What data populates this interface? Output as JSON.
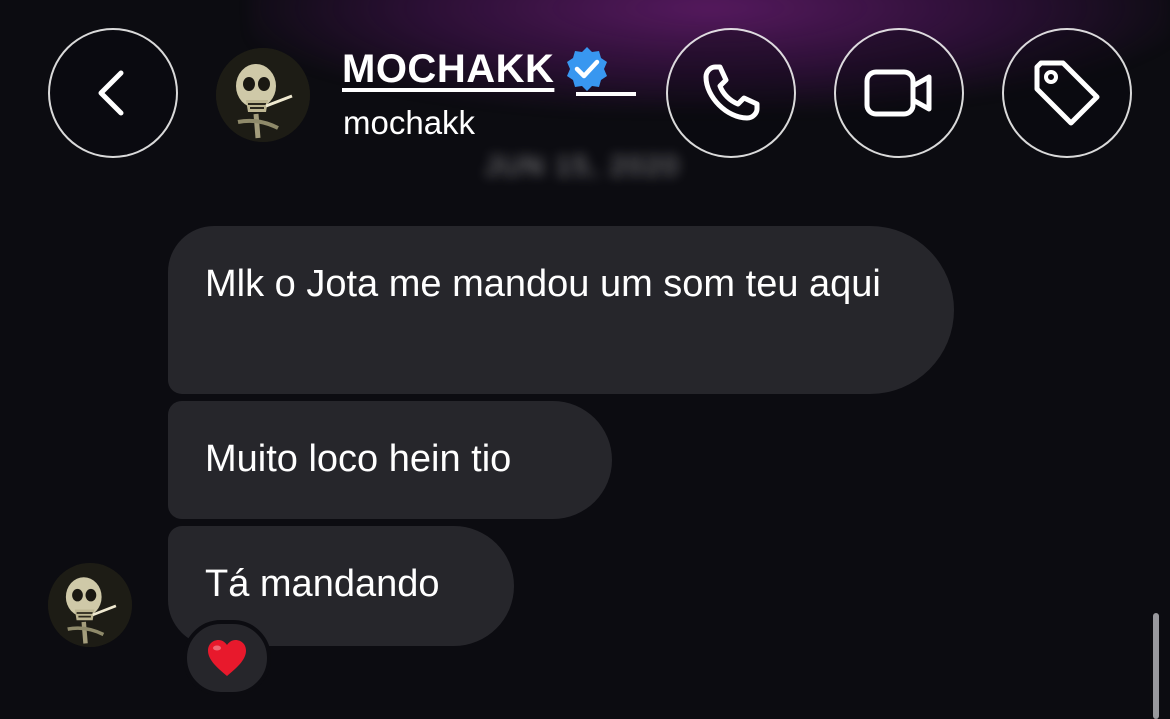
{
  "header": {
    "display_name": "MOCHAKK",
    "username": "mochakk",
    "date_label": "JUN 15, 2020",
    "icons": {
      "back": "chevron-left-icon",
      "call": "phone-icon",
      "video": "video-camera-icon",
      "tag": "tag-icon",
      "verified": "verified-badge-icon"
    },
    "colors": {
      "verified_blue": "#3897f0",
      "glow_purple": "#6e1e78"
    }
  },
  "messages": [
    {
      "text": "Mlk o Jota me mandou um som teu aqui"
    },
    {
      "text": "Muito loco hein tio"
    },
    {
      "text": "Tá mandando"
    }
  ],
  "reaction": {
    "emoji": "heart-emoji",
    "color": "#e8192c"
  },
  "colors": {
    "background": "#0c0c11",
    "bubble": "#26262b"
  }
}
